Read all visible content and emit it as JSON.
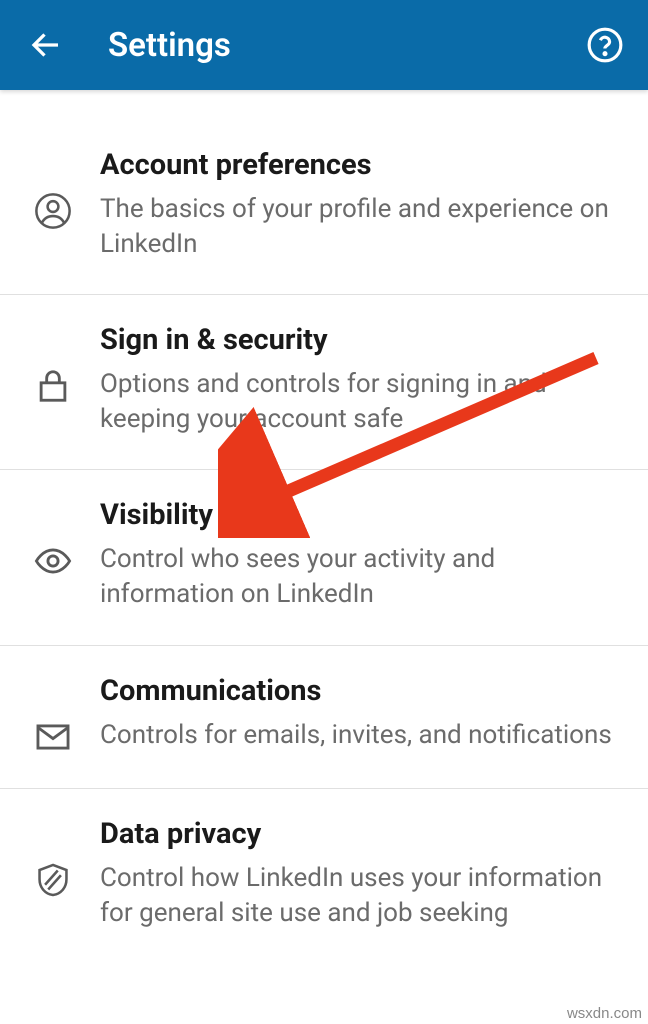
{
  "header": {
    "title": "Settings"
  },
  "sections": [
    {
      "title": "Account preferences",
      "desc": "The basics of your profile and experience on LinkedIn"
    },
    {
      "title": "Sign in & security",
      "desc": "Options and controls for signing in and keeping your account safe"
    },
    {
      "title": "Visibility",
      "desc": "Control who sees your activity and information on LinkedIn"
    },
    {
      "title": "Communications",
      "desc": "Controls for emails, invites, and notifications"
    },
    {
      "title": "Data privacy",
      "desc": "Control how LinkedIn uses your information for general site use and job seeking"
    }
  ],
  "watermark": "wsxdn.com"
}
